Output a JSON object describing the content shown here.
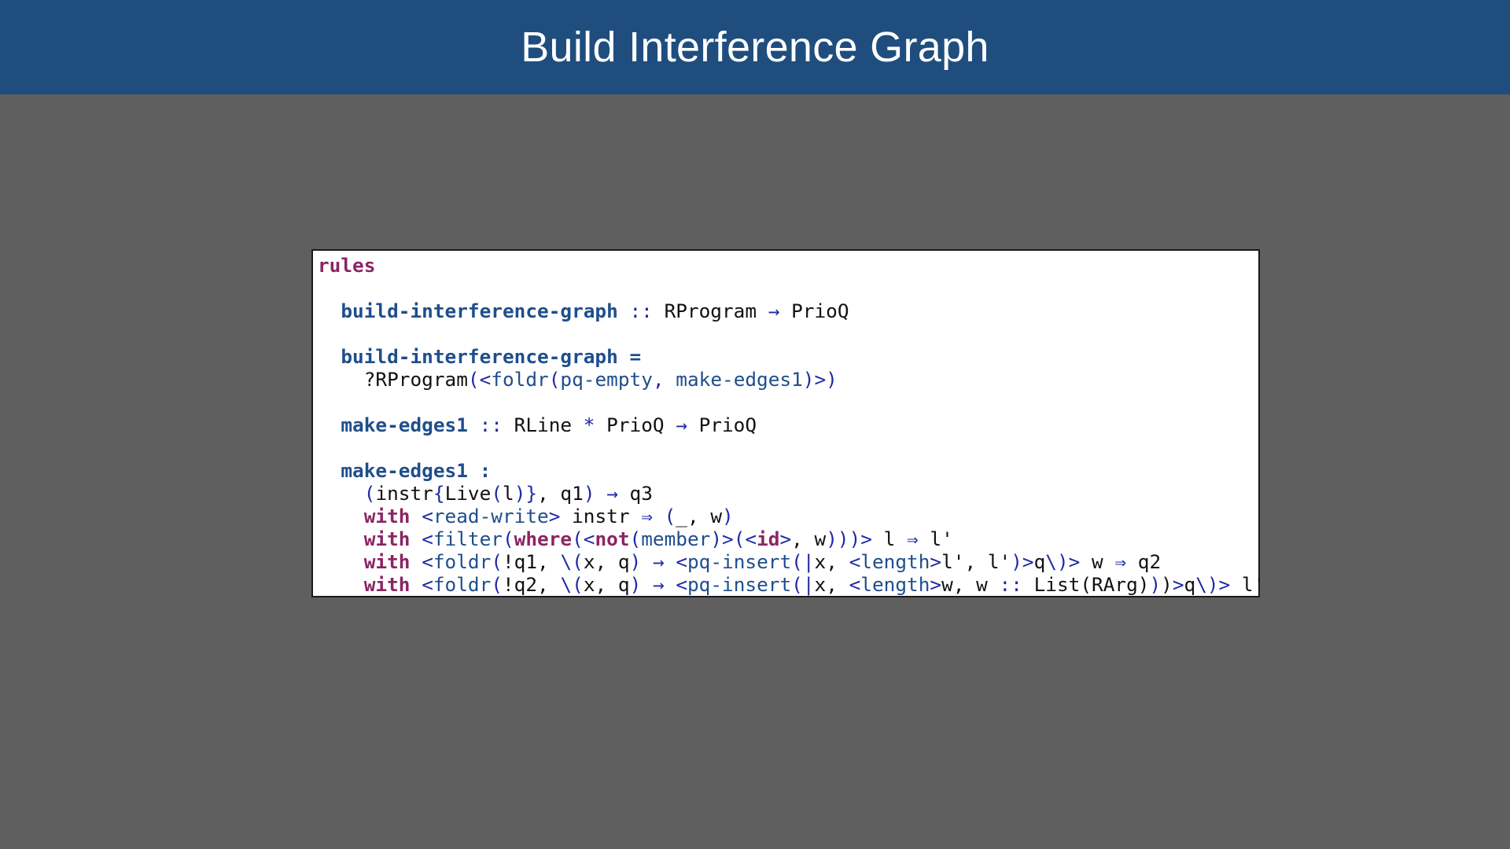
{
  "header": {
    "title": "Build Interference Graph"
  },
  "colors": {
    "header_bg": "#1f4e7e",
    "slide_bg": "#5f5f5f",
    "keyword": "#8b2563",
    "function": "#1f4e8c",
    "operator": "#1f2aa6",
    "text": "#111111"
  },
  "code": {
    "lines": [
      [
        [
          "kw",
          "rules"
        ]
      ],
      [],
      [
        [
          "tx",
          "  "
        ],
        [
          "fn",
          "build-interference-graph"
        ],
        [
          "op",
          " :: "
        ],
        [
          "tx",
          "RProgram "
        ],
        [
          "op",
          "→"
        ],
        [
          "tx",
          " PrioQ"
        ]
      ],
      [],
      [
        [
          "tx",
          "  "
        ],
        [
          "fn",
          "build-interference-graph ="
        ]
      ],
      [
        [
          "tx",
          "    ?RProgram"
        ],
        [
          "op",
          "(<"
        ],
        [
          "st",
          "foldr"
        ],
        [
          "op",
          "("
        ],
        [
          "st",
          "pq-empty"
        ],
        [
          "op",
          ", "
        ],
        [
          "st",
          "make-edges1"
        ],
        [
          "op",
          ")>)"
        ]
      ],
      [],
      [
        [
          "tx",
          "  "
        ],
        [
          "fn",
          "make-edges1"
        ],
        [
          "op",
          " :: "
        ],
        [
          "tx",
          "RLine "
        ],
        [
          "op",
          "*"
        ],
        [
          "tx",
          " PrioQ "
        ],
        [
          "op",
          "→"
        ],
        [
          "tx",
          " PrioQ"
        ]
      ],
      [],
      [
        [
          "tx",
          "  "
        ],
        [
          "fn",
          "make-edges1 :"
        ]
      ],
      [
        [
          "tx",
          "    "
        ],
        [
          "op",
          "("
        ],
        [
          "tx",
          "instr"
        ],
        [
          "op",
          "{"
        ],
        [
          "tx",
          "Live"
        ],
        [
          "op",
          "("
        ],
        [
          "tx",
          "l"
        ],
        [
          "op",
          ")}"
        ],
        [
          "tx",
          ", q1"
        ],
        [
          "op",
          ")"
        ],
        [
          "tx",
          " "
        ],
        [
          "op",
          "→"
        ],
        [
          "tx",
          " q3"
        ]
      ],
      [
        [
          "tx",
          "    "
        ],
        [
          "kw",
          "with"
        ],
        [
          "tx",
          " "
        ],
        [
          "op",
          "<"
        ],
        [
          "st",
          "read-write"
        ],
        [
          "op",
          ">"
        ],
        [
          "tx",
          " instr "
        ],
        [
          "op",
          "⇒"
        ],
        [
          "tx",
          " "
        ],
        [
          "op",
          "("
        ],
        [
          "tx",
          "_, w"
        ],
        [
          "op",
          ")"
        ]
      ],
      [
        [
          "tx",
          "    "
        ],
        [
          "kw",
          "with"
        ],
        [
          "tx",
          " "
        ],
        [
          "op",
          "<"
        ],
        [
          "st",
          "filter"
        ],
        [
          "op",
          "("
        ],
        [
          "kw",
          "where"
        ],
        [
          "op",
          "(<"
        ],
        [
          "kw",
          "not"
        ],
        [
          "op",
          "("
        ],
        [
          "st",
          "member"
        ],
        [
          "op",
          ")>(<"
        ],
        [
          "kw",
          "id"
        ],
        [
          "op",
          ">"
        ],
        [
          "tx",
          ", w"
        ],
        [
          "op",
          ")))>"
        ],
        [
          "tx",
          " l "
        ],
        [
          "op",
          "⇒"
        ],
        [
          "tx",
          " l'"
        ]
      ],
      [
        [
          "tx",
          "    "
        ],
        [
          "kw",
          "with"
        ],
        [
          "tx",
          " "
        ],
        [
          "op",
          "<"
        ],
        [
          "st",
          "foldr"
        ],
        [
          "op",
          "("
        ],
        [
          "tx",
          "!q1, "
        ],
        [
          "op",
          "\\("
        ],
        [
          "tx",
          "x, q"
        ],
        [
          "op",
          ")"
        ],
        [
          "tx",
          " "
        ],
        [
          "op",
          "→"
        ],
        [
          "tx",
          " "
        ],
        [
          "op",
          "<"
        ],
        [
          "st",
          "pq-insert"
        ],
        [
          "op",
          "(|"
        ],
        [
          "tx",
          "x, "
        ],
        [
          "op",
          "<"
        ],
        [
          "st",
          "length"
        ],
        [
          "op",
          ">"
        ],
        [
          "tx",
          "l', l'"
        ],
        [
          "op",
          ")>"
        ],
        [
          "tx",
          "q"
        ],
        [
          "op",
          "\\)>"
        ],
        [
          "tx",
          " w "
        ],
        [
          "op",
          "⇒"
        ],
        [
          "tx",
          " q2"
        ]
      ],
      [
        [
          "tx",
          "    "
        ],
        [
          "kw",
          "with"
        ],
        [
          "tx",
          " "
        ],
        [
          "op",
          "<"
        ],
        [
          "st",
          "foldr"
        ],
        [
          "op",
          "("
        ],
        [
          "tx",
          "!q2, "
        ],
        [
          "op",
          "\\("
        ],
        [
          "tx",
          "x, q"
        ],
        [
          "op",
          ")"
        ],
        [
          "tx",
          " "
        ],
        [
          "op",
          "→"
        ],
        [
          "tx",
          " "
        ],
        [
          "op",
          "<"
        ],
        [
          "st",
          "pq-insert"
        ],
        [
          "op",
          "(|"
        ],
        [
          "tx",
          "x, "
        ],
        [
          "op",
          "<"
        ],
        [
          "st",
          "length"
        ],
        [
          "op",
          ">"
        ],
        [
          "tx",
          "w, w "
        ],
        [
          "op",
          "::"
        ],
        [
          "tx",
          " List(RArg)"
        ],
        [
          "op",
          ")"
        ],
        [
          "tx",
          ")"
        ],
        [
          "op",
          ">"
        ],
        [
          "tx",
          "q"
        ],
        [
          "op",
          "\\)>"
        ],
        [
          "tx",
          " l'"
        ]
      ]
    ]
  }
}
